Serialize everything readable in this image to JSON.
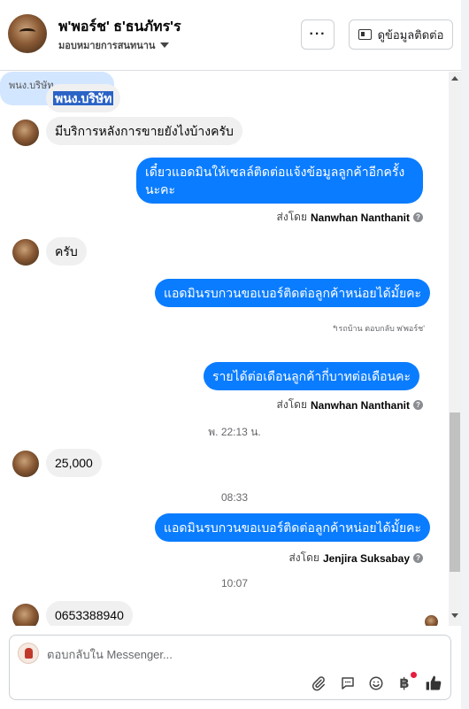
{
  "header": {
    "contact_name": "พ'พอร์ช' ธ'ธนภัทร'ร",
    "assigned_label": "มอบหมายการสนทนาน",
    "more_label": "···",
    "contact_info_label": "ดูข้อมูลติดต่อ"
  },
  "messages": {
    "m1": "พนง.บริษัท",
    "m2": "มีบริการหลังการขายยังไงบ้างครับ",
    "m3": "เดี๋ยวแอดมินให้เซลล์ติดต่อแจ้งข้อมูลลูกค้าอีกครั้งนะคะ",
    "m4": "ครับ",
    "m5": "แอดมินรบกวนขอเบอร์ติดต่อลูกค้าหน่อยได้มั้ยคะ",
    "reply_note": "↰รถบ้าน ตอบกลับ พ'พอร์ช'",
    "quoted": "พนง.บริษัท",
    "m6": "รายได้ต่อเดือนลูกค้ากี่บาทต่อเดือนคะ",
    "m7": "25,000",
    "m8": "แอดมินรบกวนขอเบอร์ติดต่อลูกค้าหน่อยได้มั้ยคะ",
    "m9": "0653388940"
  },
  "sent_by": {
    "prefix": "ส่งโดย",
    "s1": "Nanwhan Nanthanit",
    "s2": "Nanwhan Nanthanit",
    "s3": "Jenjira Suksabay"
  },
  "timestamps": {
    "t1": "พ. 22:13 น.",
    "t2": "08:33",
    "t3": "10:07"
  },
  "composer": {
    "placeholder": "ตอบกลับใน Messenger..."
  },
  "colors": {
    "outgoing_bubble": "#0a7cff",
    "incoming_bubble": "#f0f0f0",
    "quoted_bubble": "#d3e6ff"
  },
  "icons": [
    "ellipsis-icon",
    "contact-card-icon",
    "paperclip-icon",
    "chat-icon",
    "emoji-icon",
    "baht-icon",
    "thumbs-up-icon",
    "help-icon",
    "caret-down-icon"
  ]
}
